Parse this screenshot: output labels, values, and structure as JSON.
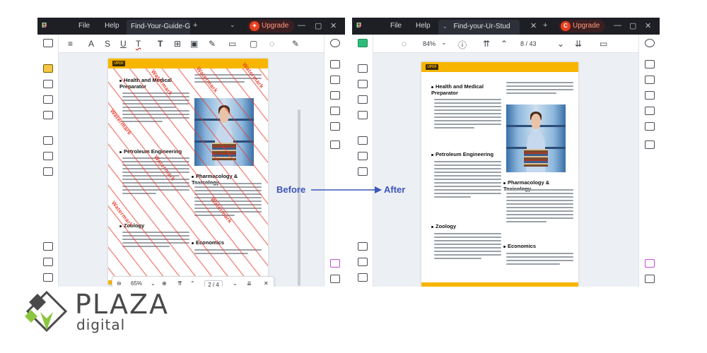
{
  "windows": [
    {
      "id": "before",
      "app_name": {
        "u": "U",
        "p": "P",
        "d": "D",
        "f": "F"
      },
      "menu": [
        "File",
        "Help"
      ],
      "tab_title": "Find-Your-Guide-G...",
      "upgrade_label": "Upgrade",
      "float": {
        "zoom": "65%",
        "page": "2 / 4"
      }
    },
    {
      "id": "after",
      "app_name": {
        "u": "U",
        "p": "P",
        "d": "D",
        "f": "F"
      },
      "menu": [
        "File",
        "Help"
      ],
      "tab_title": "Find-your-Ur-Stud",
      "upgrade_label": "Upgrade",
      "toolbar": {
        "zoom": "84%",
        "page": "8 / 43"
      }
    }
  ],
  "document": {
    "brand": "UPDF",
    "headings": [
      "Health and Medical Preparator",
      "Petroleum Engineering",
      "Zoology",
      "Pharmacology & Toxicology",
      "Economics"
    ],
    "watermark_text": "Watermark"
  },
  "labels": {
    "before": "Before",
    "after": "After"
  },
  "brand_logo": {
    "name": "PLAZA",
    "sub": "digital"
  },
  "colors": {
    "accent": "#3d55b8",
    "page_header": "#f7b500",
    "watermark": "#e8392b"
  }
}
